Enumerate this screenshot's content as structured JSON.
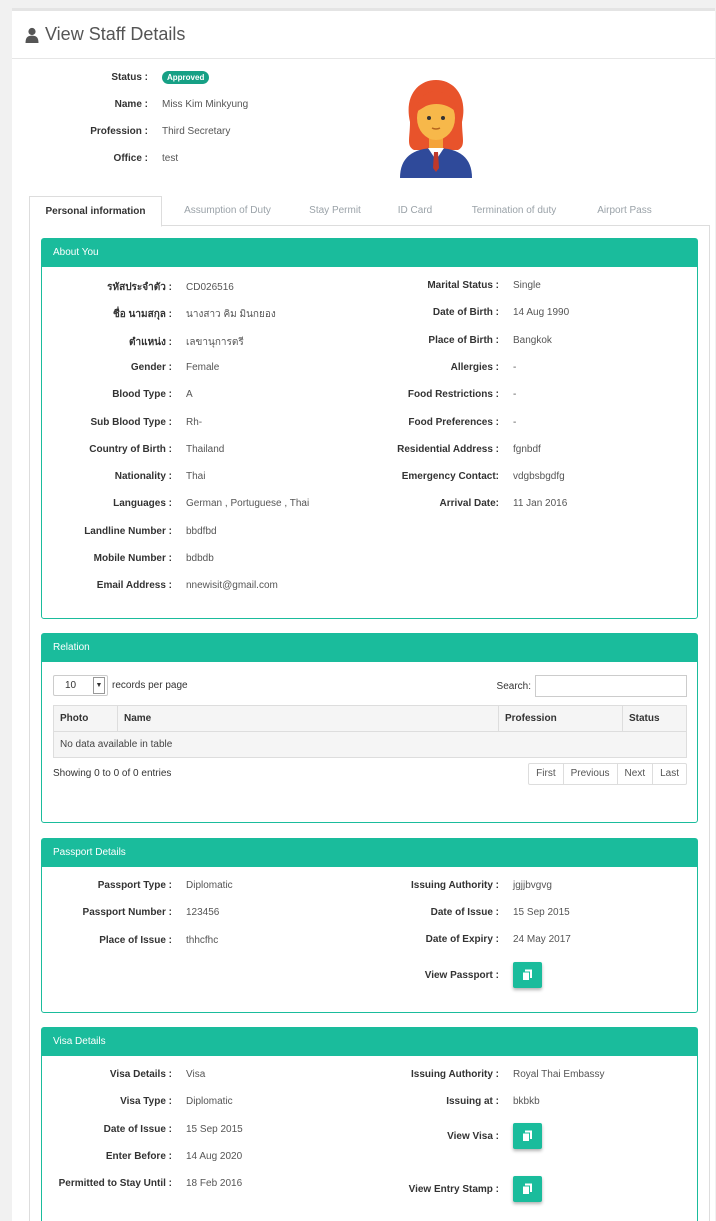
{
  "header": {
    "title": "View Staff Details",
    "icon": "user-icon"
  },
  "summary": {
    "status_label": "Status :",
    "status_value": "Approved",
    "name_label": "Name :",
    "name_value": "Miss Kim Minkyung",
    "profession_label": "Profession :",
    "profession_value": "Third Secretary",
    "office_label": "Office :",
    "office_value": "test"
  },
  "tabs": [
    {
      "label": "Personal information"
    },
    {
      "label": "Assumption of Duty"
    },
    {
      "label": "Stay Permit"
    },
    {
      "label": "ID Card"
    },
    {
      "label": "Termination of duty"
    },
    {
      "label": "Airport Pass"
    }
  ],
  "about": {
    "title": "About You",
    "left": [
      {
        "k": "รหัสประจำตัว :",
        "v": "CD026516"
      },
      {
        "k": "ชื่อ นามสกุล :",
        "v": "นางสาว คิม มินกยอง"
      },
      {
        "k": "ตำแหน่ง :",
        "v": "เลขานุการตรี"
      },
      {
        "k": "Gender :",
        "v": "Female"
      },
      {
        "k": "Blood Type :",
        "v": "A"
      },
      {
        "k": "Sub Blood Type :",
        "v": "Rh-"
      },
      {
        "k": "Country of Birth :",
        "v": "Thailand"
      },
      {
        "k": "Nationality :",
        "v": "Thai"
      },
      {
        "k": "Languages :",
        "v": "German , Portuguese , Thai"
      },
      {
        "k": "Landline Number :",
        "v": "bbdfbd"
      },
      {
        "k": "Mobile Number :",
        "v": "bdbdb"
      },
      {
        "k": "Email Address :",
        "v": "nnewisit@gmail.com"
      }
    ],
    "right": [
      {
        "k": "Marital Status :",
        "v": "Single"
      },
      {
        "k": "Date of Birth :",
        "v": "14 Aug 1990"
      },
      {
        "k": "Place of Birth :",
        "v": "Bangkok"
      },
      {
        "k": "Allergies :",
        "v": "-"
      },
      {
        "k": "Food Restrictions :",
        "v": "-"
      },
      {
        "k": "Food Preferences :",
        "v": "-"
      },
      {
        "k": "Residential Address :",
        "v": "fgnbdf"
      },
      {
        "k": "Emergency Contact:",
        "v": "vdgbsbgdfg"
      },
      {
        "k": "Arrival Date:",
        "v": "11 Jan 2016"
      }
    ]
  },
  "relation": {
    "title": "Relation",
    "page_length": "10",
    "length_text": "records per page",
    "search_label": "Search:",
    "search_value": "",
    "columns": [
      "Photo",
      "Name",
      "Profession",
      "Status"
    ],
    "empty_text": "No data available in table",
    "info": "Showing 0 to 0 of 0 entries",
    "pager": [
      "First",
      "Previous",
      "Next",
      "Last"
    ]
  },
  "passport": {
    "title": "Passport Details",
    "left": [
      {
        "k": "Passport Type :",
        "v": "Diplomatic"
      },
      {
        "k": "Passport Number :",
        "v": "123456"
      },
      {
        "k": "Place of Issue :",
        "v": "thhcfhc"
      }
    ],
    "right": [
      {
        "k": "Issuing Authority :",
        "v": "jgjjbvgvg"
      },
      {
        "k": "Date of Issue :",
        "v": "15 Sep 2015"
      },
      {
        "k": "Date of Expiry :",
        "v": "24 May 2017"
      },
      {
        "k": "View Passport :",
        "v": ""
      }
    ]
  },
  "visa": {
    "title": "Visa Details",
    "left": [
      {
        "k": "Visa Details :",
        "v": "Visa"
      },
      {
        "k": "Visa Type :",
        "v": "Diplomatic"
      },
      {
        "k": "Date of Issue :",
        "v": "15 Sep 2015"
      },
      {
        "k": "Enter Before :",
        "v": "14 Aug 2020"
      },
      {
        "k": "Permitted to Stay Until :",
        "v": "18 Feb 2016"
      }
    ],
    "right": [
      {
        "k": "Issuing Authority :",
        "v": "Royal Thai Embassy"
      },
      {
        "k": "Issuing at :",
        "v": "bkbkb"
      },
      {
        "k": "View Visa :",
        "v": ""
      },
      {
        "k": "View Entry Stamp :",
        "v": ""
      }
    ]
  },
  "colors": {
    "accent": "#1abc9c",
    "badge": "#16a085",
    "link": "#2a6fb5"
  }
}
